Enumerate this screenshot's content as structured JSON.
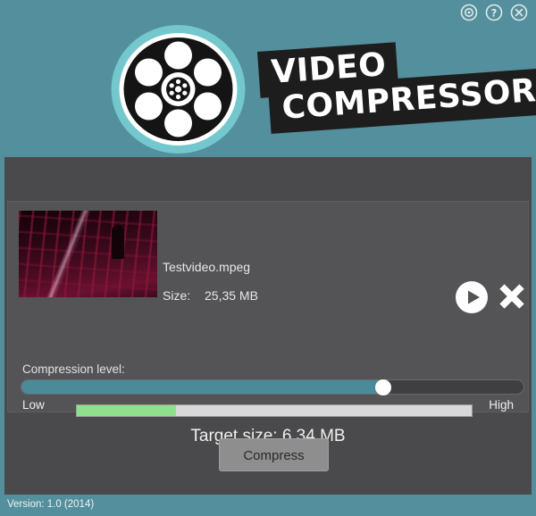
{
  "app": {
    "title_line1": "VIDEO",
    "title_line2": "COMPRESSOR",
    "logo_icon": "film-reel-icon",
    "header_color": "#538f9c",
    "body_color": "#4a4a4c",
    "panel_color": "#545456"
  },
  "window_controls": [
    {
      "name": "settings-icon",
      "glyph": "◎",
      "tooltip": "Settings"
    },
    {
      "name": "help-icon",
      "glyph": "?",
      "tooltip": "Help"
    },
    {
      "name": "close-icon",
      "glyph": "✕",
      "tooltip": "Close"
    }
  ],
  "file": {
    "thumbnail_icon": "video-thumbnail",
    "name": "Testvideo.mpeg",
    "size_label": "Size:",
    "size_value": "25,35 MB",
    "play_icon": "play-icon",
    "remove_icon": "close-x-icon"
  },
  "compression": {
    "label": "Compression level:",
    "slider_value": 72,
    "slider_min_label": "Low",
    "slider_max_label": "High",
    "slider_fill_color": "#4b8a99",
    "progress_percent": 25,
    "progress_fill_color": "#8fe08c",
    "target_size_text": "Target size: 6,34 MB"
  },
  "actions": {
    "compress_label": "Compress"
  },
  "footer": {
    "version_text": "Version: 1.0 (2014)"
  }
}
